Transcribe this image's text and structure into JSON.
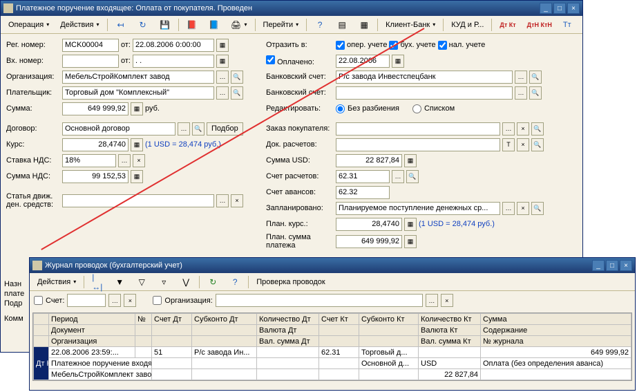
{
  "w1": {
    "title": "Платежное поручение входящее: Оплата от покупателя. Проведен",
    "toolbar": {
      "op": "Операция",
      "act": "Действия",
      "go": "Перейти",
      "cb": "Клиент-Банк",
      "kud": "КУД и Р...",
      "dtkt": "Дт Кт",
      "dtktn": "ДтН КтН",
      "tt": "Тт"
    },
    "labels": {
      "regno": "Рег. номер:",
      "from": "от:",
      "vhno": "Вх. номер:",
      "org": "Организация:",
      "payer": "Плательщик:",
      "sum": "Сумма:",
      "rub": "руб.",
      "dog": "Договор:",
      "podbor": "Подбор",
      "kurs": "Курс:",
      "ratehint": "(1 USD = 28,474 руб.)",
      "stavka": "Ставка НДС:",
      "sumnds": "Сумма НДС:",
      "statya": "Статья движ. ден. средств:",
      "otrazit": "Отразить в:",
      "oper": "опер. учете",
      "bux": "бух. учете",
      "nal": "нал. учете",
      "opl": "Оплачено:",
      "bank1": "Банковский счет:",
      "bank2": "Банковский счет:",
      "redact": "Редактировать:",
      "bezraz": "Без разбиения",
      "spiskom": "Списком",
      "zakaz": "Заказ покупателя:",
      "dokras": "Док. расчетов:",
      "sumusd": "Сумма USD:",
      "schetras": "Счет расчетов:",
      "schetav": "Счет авансов:",
      "zaplan": "Запланировано:",
      "plankurs": "План. курс.:",
      "plansum": "План. сумма платежа"
    },
    "values": {
      "regno": "MCK00004",
      "date": "22.08.2006 0:00:00",
      "vhdate": ". .",
      "org": "МебельСтройКомплект завод",
      "payer": "Торговый дом \"Комплексный\"",
      "sum": "649 999,92",
      "dog": "Основной договор",
      "kurs": "28,4740",
      "stavka": "18%",
      "sumnds": "99 152,53",
      "opldate": "22.08.2006",
      "bank1": "Р/с завода Инвестспецбанк",
      "sumusd": "22 827,84",
      "schetras": "62.31",
      "schetav": "62.32",
      "zaplan": "Планируемое поступление денежных ср...",
      "plankurs": "28,4740",
      "plansum": "649 999,92"
    },
    "side": {
      "n": "Назн",
      "p": "плате",
      "pd": "Подр",
      "k": "Комм"
    }
  },
  "w2": {
    "title": "Журнал проводок (бухгалтерский учет)",
    "toolbar": {
      "act": "Действия",
      "check": "Проверка проводок"
    },
    "filter": {
      "schet": "Счет:",
      "org": "Организация:"
    },
    "headers": {
      "period": "Период",
      "no": "№",
      "schetdt": "Счет Дт",
      "subdt": "Субконто Дт",
      "koldt": "Количество Дт",
      "schetkt": "Счет Кт",
      "subkt": "Субконто Кт",
      "kolkt": "Количество Кт",
      "summa": "Сумма",
      "dok": "Документ",
      "valdt": "Валюта Дт",
      "valkt": "Валюта Кт",
      "sod": "Содержание",
      "org": "Организация",
      "valsdt": "Вал. сумма Дт",
      "valskt": "Вал. сумма Кт",
      "jno": "№ журнала"
    },
    "rows": {
      "r1": {
        "period": "22.08.2006 23:59:...",
        "schetdt": "51",
        "subdt": "Р/с завода Ин...",
        "schetkt": "62.31",
        "subkt": "Торговый д...",
        "summa": "649 999,92"
      },
      "r2": {
        "dok": "Платежное поручение входя...",
        "subkt": "Основной д...",
        "valkt": "USD",
        "sod": "Оплата (без определения аванса)"
      },
      "r3": {
        "org": "МебельСтройКомплект завод",
        "valskt": "22 827,84"
      }
    },
    "mark": "Дт Кт"
  }
}
